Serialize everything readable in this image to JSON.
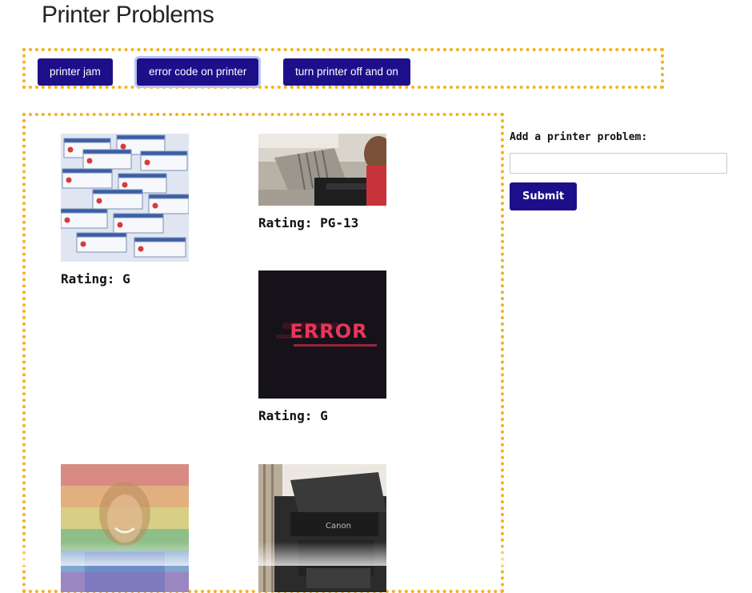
{
  "page": {
    "title": "Printer Problems"
  },
  "topics": [
    {
      "label": "printer jam"
    },
    {
      "label": "error code on printer"
    },
    {
      "label": "turn printer off and on"
    }
  ],
  "gifs": [
    {
      "image": "stacked-error-dialogs-image",
      "rating": "Rating: G"
    },
    {
      "image": "person-at-printer-image",
      "rating": "Rating: PG-13"
    },
    {
      "image": "error-screen-image",
      "rating": "Rating: G",
      "image_text": "ERROR"
    },
    {
      "image": "rainbow-portrait-image"
    },
    {
      "image": "canon-printer-image",
      "image_text": "Canon"
    }
  ],
  "form": {
    "label": "Add a printer problem:",
    "input_value": "",
    "input_placeholder": "",
    "submit_label": "Submit"
  },
  "colors": {
    "button_bg": "#1d0f8a",
    "dotted_border": "#f5b21a",
    "title_text": "#212529"
  }
}
